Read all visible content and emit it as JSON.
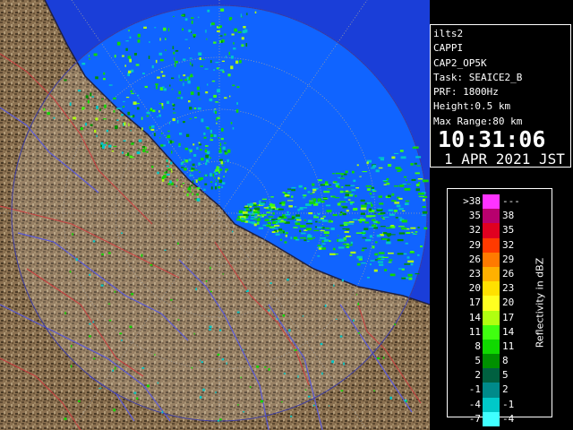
{
  "info": {
    "site": "ilts2",
    "product": "CAPPI",
    "product_id": "CAP2_OP5K",
    "task": "Task: SEAICE2_B",
    "prf": "PRF: 1800Hz",
    "height": "Height:0.5 km",
    "max_range": "Max Range:80 km",
    "time": "10:31:06",
    "date": "1 APR 2021 JST"
  },
  "legend": {
    "title": "Reflectivity in dBZ",
    "rows": [
      {
        "lo": ">38",
        "hi": "---",
        "color": "#ff33ff"
      },
      {
        "lo": "35",
        "hi": "38",
        "color": "#b8006e"
      },
      {
        "lo": "32",
        "hi": "35",
        "color": "#e00020"
      },
      {
        "lo": "29",
        "hi": "32",
        "color": "#ff3a00"
      },
      {
        "lo": "26",
        "hi": "29",
        "color": "#ff7a00"
      },
      {
        "lo": "23",
        "hi": "26",
        "color": "#ffb000"
      },
      {
        "lo": "20",
        "hi": "23",
        "color": "#ffe000"
      },
      {
        "lo": "17",
        "hi": "20",
        "color": "#ffff20"
      },
      {
        "lo": "14",
        "hi": "17",
        "color": "#b0ff10"
      },
      {
        "lo": "11",
        "hi": "14",
        "color": "#40ff10"
      },
      {
        "lo": "8",
        "hi": "11",
        "color": "#10d800"
      },
      {
        "lo": "5",
        "hi": "8",
        "color": "#009000"
      },
      {
        "lo": "2",
        "hi": "5",
        "color": "#006040"
      },
      {
        "lo": "-1",
        "hi": "2",
        "color": "#008a8a"
      },
      {
        "lo": "-4",
        "hi": "-1",
        "color": "#00c8c8"
      },
      {
        "lo": "-7",
        "hi": "-4",
        "color": "#40ffff"
      }
    ]
  },
  "colors": {
    "sea": "#1060ff",
    "sea_far": "#1838e0",
    "land": "#8a7050",
    "river": "#5a5ad8",
    "road": "#c84040",
    "background": "#000000"
  }
}
